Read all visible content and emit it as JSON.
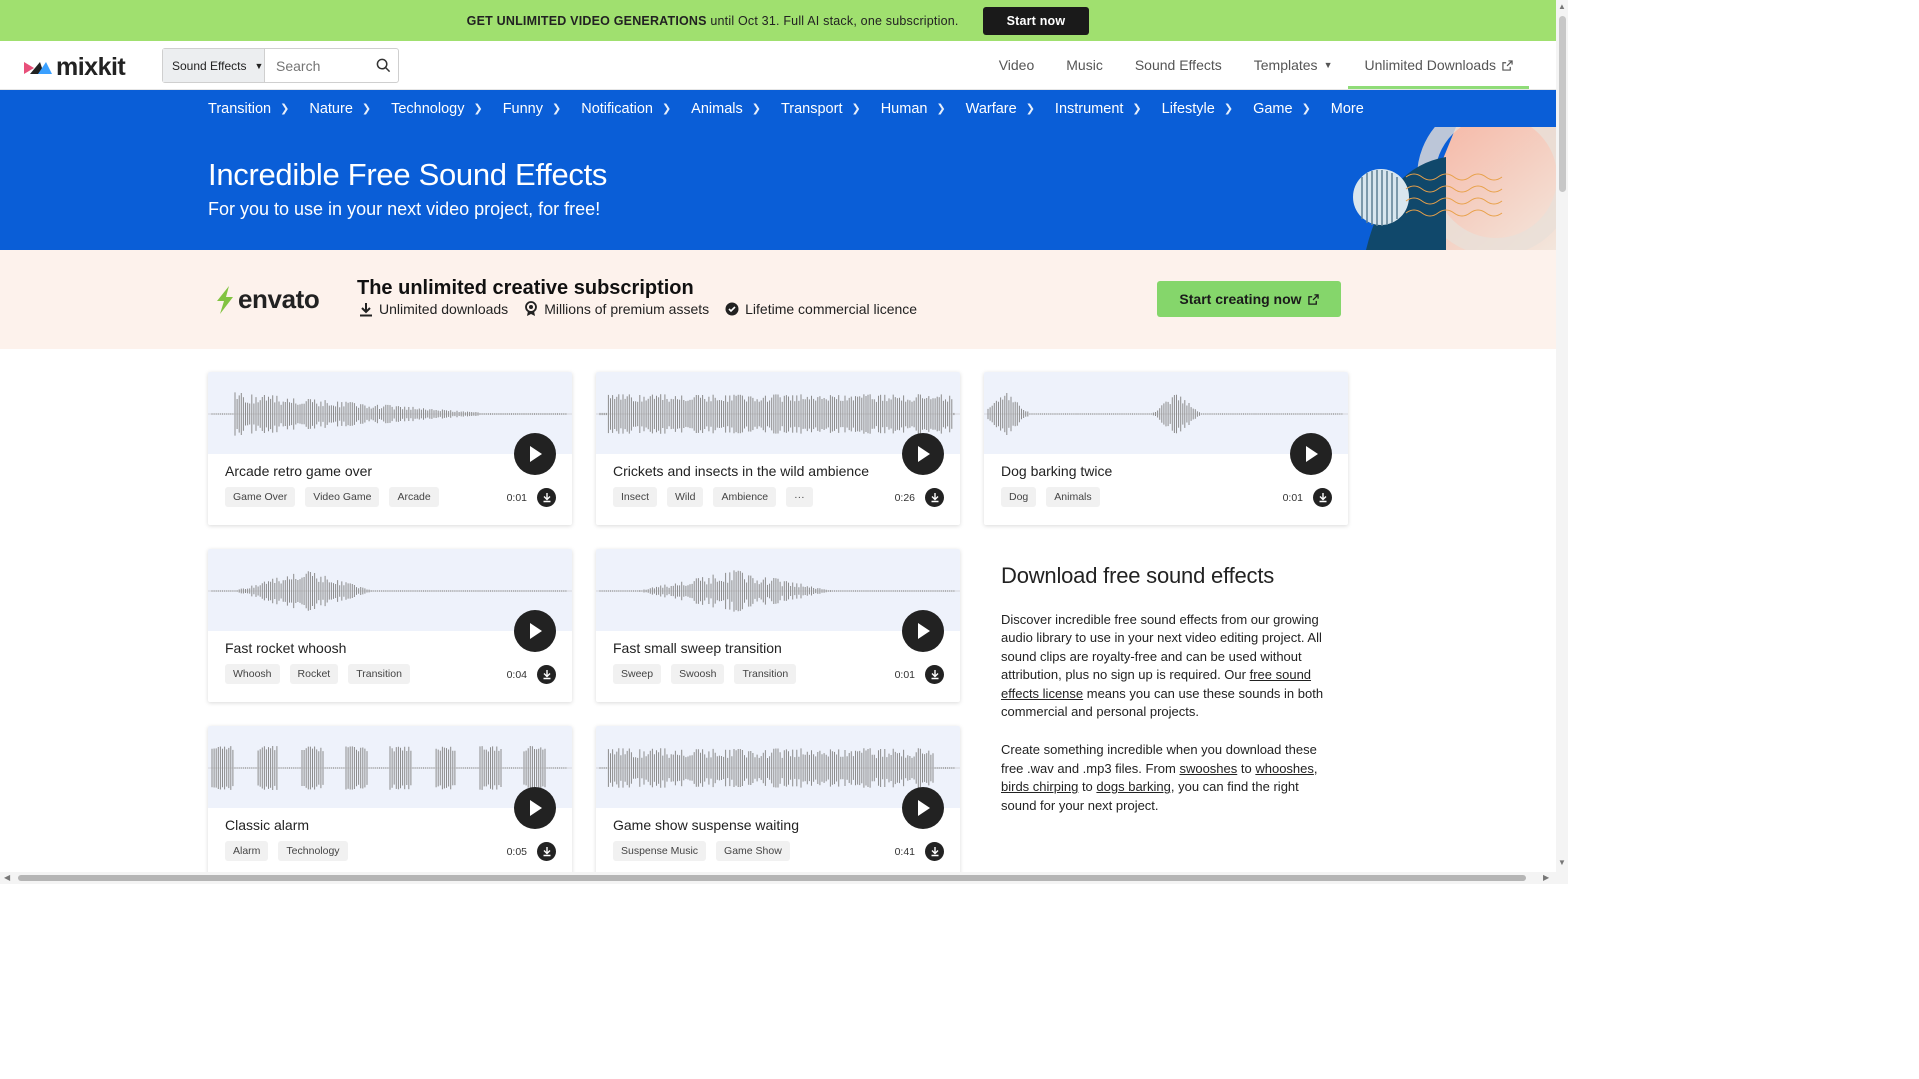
{
  "promo": {
    "highlight": "GET UNLIMITED VIDEO GENERATIONS",
    "rest": " until Oct 31. Full AI stack, one subscription.",
    "button": "Start now"
  },
  "header": {
    "logo": "mixkit",
    "search_category": "Sound Effects",
    "search_placeholder": "Search",
    "nav": [
      "Video",
      "Music",
      "Sound Effects",
      "Templates",
      "Unlimited Downloads"
    ]
  },
  "categories": [
    "Transition",
    "Nature",
    "Technology",
    "Funny",
    "Notification",
    "Animals",
    "Transport",
    "Human",
    "Warfare",
    "Instrument",
    "Lifestyle",
    "Game",
    "More"
  ],
  "hero": {
    "title": "Incredible Free Sound Effects",
    "subtitle": "For you to use in your next video project, for free!"
  },
  "envato": {
    "logo": "envato",
    "title": "The unlimited creative subscription",
    "features": [
      "Unlimited downloads",
      "Millions of premium assets",
      "Lifetime commercial licence"
    ],
    "button": "Start creating now"
  },
  "cards": [
    {
      "title": "Arcade retro game over",
      "tags": [
        "Game Over",
        "Video Game",
        "Arcade"
      ],
      "duration": "0:01",
      "wave": "decay"
    },
    {
      "title": "Crickets and insects in the wild ambience",
      "tags": [
        "Insect",
        "Wild",
        "Ambience",
        "···"
      ],
      "duration": "0:26",
      "wave": "full"
    },
    {
      "title": "Dog barking twice",
      "tags": [
        "Dog",
        "Animals"
      ],
      "duration": "0:01",
      "wave": "two"
    },
    {
      "title": "Fast rocket whoosh",
      "tags": [
        "Whoosh",
        "Rocket",
        "Transition"
      ],
      "duration": "0:04",
      "wave": "center"
    },
    {
      "title": "Fast small sweep transition",
      "tags": [
        "Sweep",
        "Swoosh",
        "Transition"
      ],
      "duration": "0:01",
      "wave": "center2"
    },
    {
      "title": "Classic alarm",
      "tags": [
        "Alarm",
        "Technology"
      ],
      "duration": "0:05",
      "wave": "bursts"
    },
    {
      "title": "Game show suspense waiting",
      "tags": [
        "Suspense Music",
        "Game Show"
      ],
      "duration": "0:41",
      "wave": "full2"
    }
  ],
  "info": {
    "title": "Download free sound effects",
    "p1_a": "Discover incredible free sound effects from our growing audio library to use in your next video editing project. All sound clips are royalty-free and can be used without attribution, plus no sign up is required. Our ",
    "p1_link": "free sound effects license",
    "p1_b": " means you can use these sounds in both commercial and personal projects.",
    "p2_a": "Create something incredible when you download these free .wav and .mp3 files. From ",
    "p2_l1": "swooshes",
    "p2_b": " to ",
    "p2_l2": "whooshes",
    "p2_c": ", ",
    "p2_l3": "birds chirping",
    "p2_d": " to ",
    "p2_l4": "dogs barking",
    "p2_e": ", you can find the right sound for your next project."
  },
  "colors": {
    "promo_bg": "#a0e06f",
    "brand_blue": "#0a5ed7",
    "envato_green": "#85d66b",
    "envato_bg": "#fdf2ec"
  }
}
